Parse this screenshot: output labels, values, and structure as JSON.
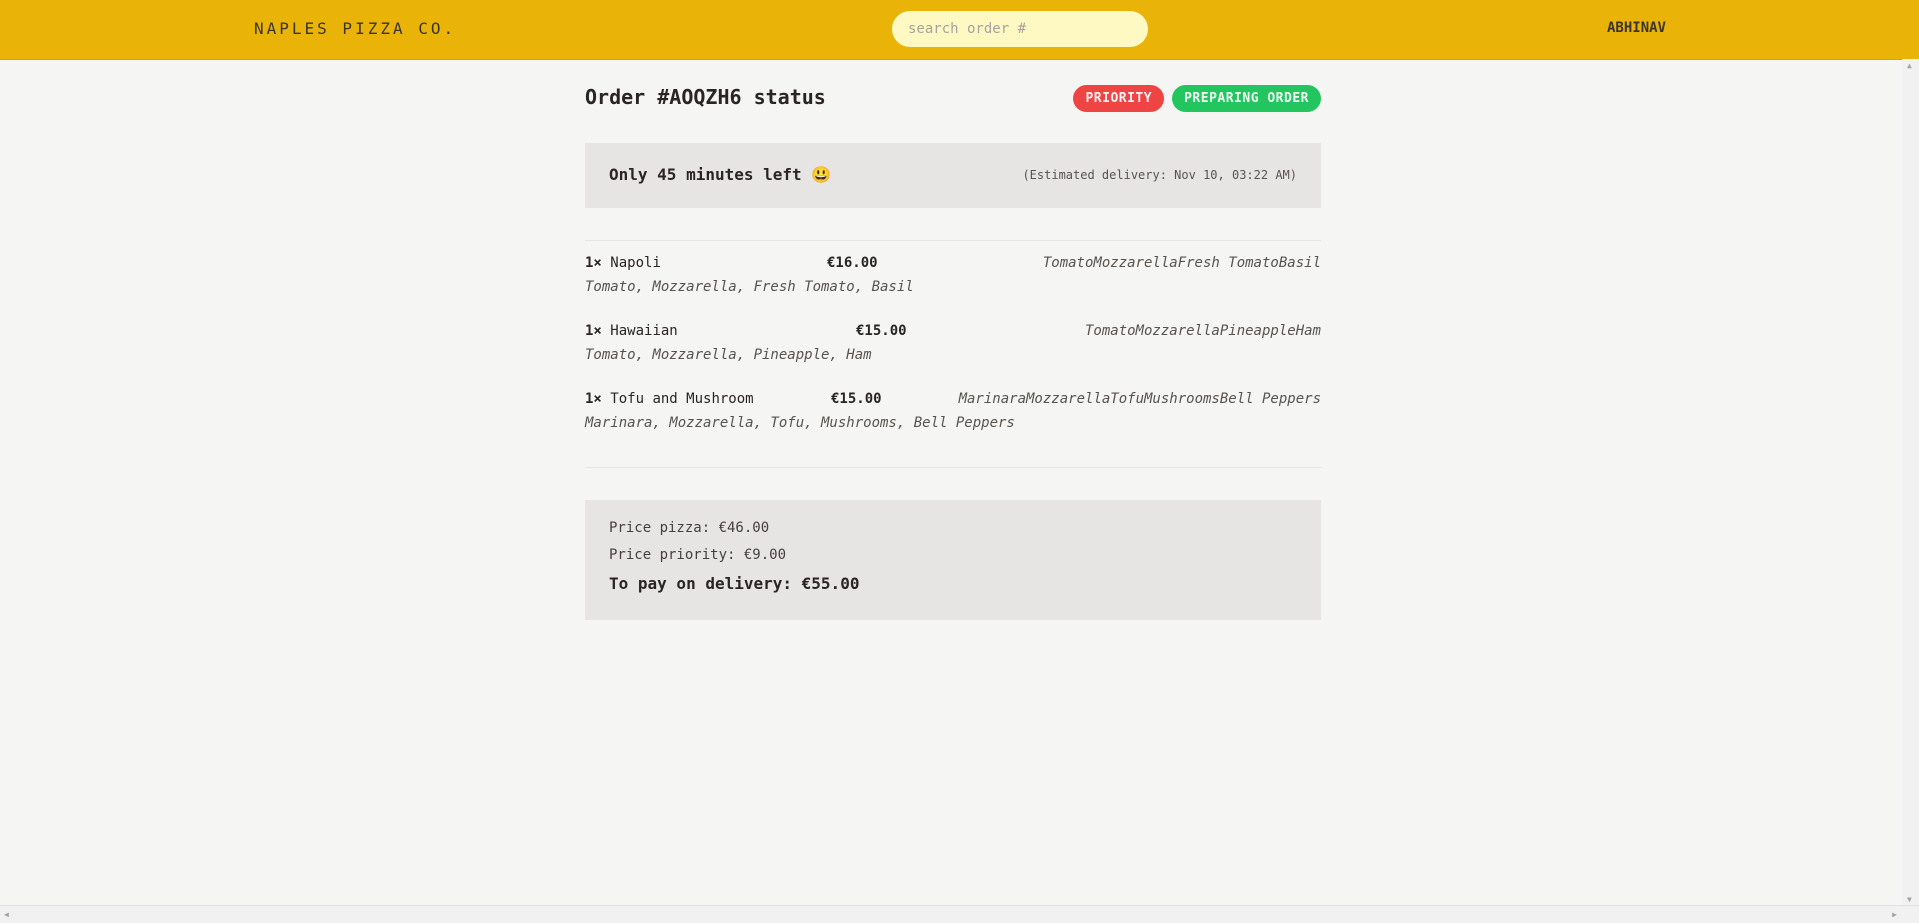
{
  "header": {
    "logo": "NAPLES PIZZA CO.",
    "search_placeholder": "search order #",
    "username": "ABHINAV"
  },
  "order": {
    "title": "Order #AOQZH6 status",
    "badges": {
      "priority": "PRIORITY",
      "status": "PREPARING ORDER"
    },
    "eta": {
      "remaining": "Only 45 minutes left 😃",
      "estimated": "(Estimated delivery: Nov 10, 03:22 AM)"
    },
    "items": [
      {
        "qty": "1×",
        "name": "Napoli",
        "price": "€16.00",
        "ingredients_joined": "TomatoMozzarellaFresh TomatoBasil",
        "ingredients": "Tomato, Mozzarella, Fresh Tomato, Basil"
      },
      {
        "qty": "1×",
        "name": "Hawaiian",
        "price": "€15.00",
        "ingredients_joined": "TomatoMozzarellaPineappleHam",
        "ingredients": "Tomato, Mozzarella, Pineapple, Ham"
      },
      {
        "qty": "1×",
        "name": "Tofu and Mushroom",
        "price": "€15.00",
        "ingredients_joined": "MarinaraMozzarellaTofuMushroomsBell Peppers",
        "ingredients": "Marinara, Mozzarella, Tofu, Mushrooms, Bell Peppers"
      }
    ],
    "totals": {
      "price_pizza": "Price pizza: €46.00",
      "price_priority": "Price priority: €9.00",
      "to_pay": "To pay on delivery: €55.00"
    }
  },
  "colors": {
    "header_bg": "#eab308",
    "priority_badge": "#ef4444",
    "status_badge": "#22c55e",
    "panel_bg": "#e7e5e4"
  }
}
